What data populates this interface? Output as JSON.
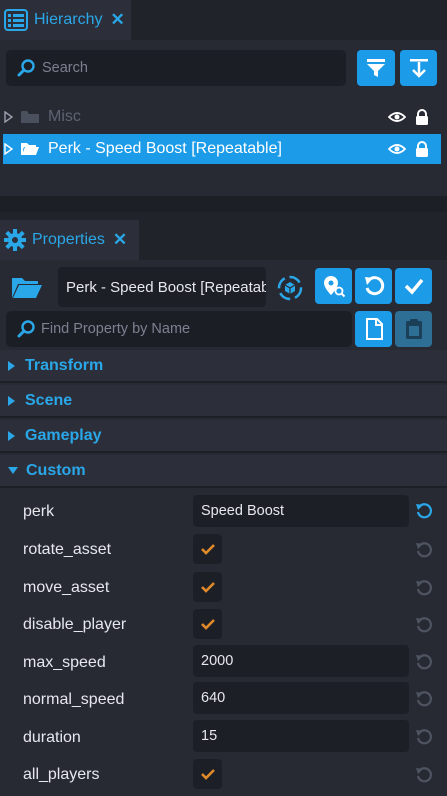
{
  "hierarchy": {
    "tab_title": "Hierarchy",
    "search_placeholder": "Search",
    "items": [
      {
        "label": "Misc"
      },
      {
        "label": "Perk - Speed Boost [Repeatable]"
      }
    ]
  },
  "properties": {
    "tab_title": "Properties",
    "object_name": "Perk - Speed Boost [Repeatable]",
    "find_placeholder": "Find Property by Name",
    "sections": {
      "transform": "Transform",
      "scene": "Scene",
      "gameplay": "Gameplay",
      "custom": "Custom"
    },
    "custom_props": {
      "perk": {
        "label": "perk",
        "value": "Speed Boost"
      },
      "rotate_asset": {
        "label": "rotate_asset",
        "checked": true
      },
      "move_asset": {
        "label": "move_asset",
        "checked": true
      },
      "disable_player": {
        "label": "disable_player",
        "checked": true
      },
      "max_speed": {
        "label": "max_speed",
        "value": "2000"
      },
      "normal_speed": {
        "label": "normal_speed",
        "value": "640"
      },
      "duration": {
        "label": "duration",
        "value": "15"
      },
      "all_players": {
        "label": "all_players",
        "checked": true
      }
    }
  },
  "colors": {
    "accent": "#2aa7e8",
    "selection": "#1c9be8",
    "check": "#e08a2a",
    "background": "#272a33"
  }
}
